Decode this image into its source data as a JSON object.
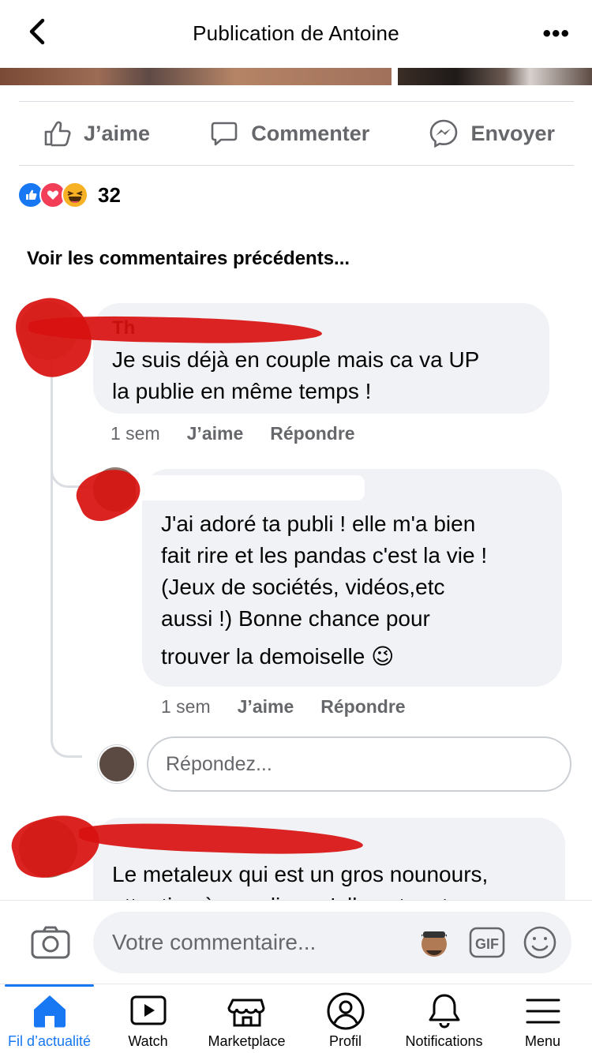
{
  "header": {
    "title": "Publication de Antoine",
    "more": "•••"
  },
  "actions": {
    "like": "J’aime",
    "comment": "Commenter",
    "send": "Envoyer"
  },
  "reactions": {
    "count": "32",
    "icons": [
      "like-icon",
      "love-icon",
      "haha-icon"
    ]
  },
  "prev_comments": "Voir les commentaires précédents...",
  "comments": [
    {
      "author_partial": "Th",
      "text_line1": "Je suis déjà en couple mais ca va UP",
      "text_line2": "la publie en même temps !",
      "time": "1 sem",
      "like": "J’aime",
      "reply": "Répondre"
    },
    {
      "text_line1": "J'ai adoré ta publi ! elle m'a bien",
      "text_line2": "fait rire et les pandas c'est la vie !",
      "text_line3": "(Jeux de sociétés, vidéos,etc",
      "text_line4": "aussi !) Bonne chance pour",
      "text_line5": "trouver la demoiselle",
      "emoji": "😉",
      "time": "1 sem",
      "like": "J’aime",
      "reply": "Répondre"
    },
    {
      "text_line1": "Le metaleux qui est un gros nounours,",
      "text_line2": "attention à pas dire qu'elle est mature"
    }
  ],
  "reply_input": {
    "placeholder": "Répondez..."
  },
  "composer": {
    "placeholder": "Votre commentaire...",
    "gif": "GIF"
  },
  "tabs": [
    {
      "label": "Fil d’actualité",
      "icon": "home-icon",
      "active": true
    },
    {
      "label": "Watch",
      "icon": "watch-icon"
    },
    {
      "label": "Marketplace",
      "icon": "marketplace-icon"
    },
    {
      "label": "Profil",
      "icon": "profile-icon"
    },
    {
      "label": "Notifications",
      "icon": "bell-icon"
    },
    {
      "label": "Menu",
      "icon": "menu-icon"
    }
  ],
  "colors": {
    "accent": "#1877f2",
    "bubble": "#f0f2f5",
    "muted": "#65676b",
    "redaction": "#d8110f"
  }
}
